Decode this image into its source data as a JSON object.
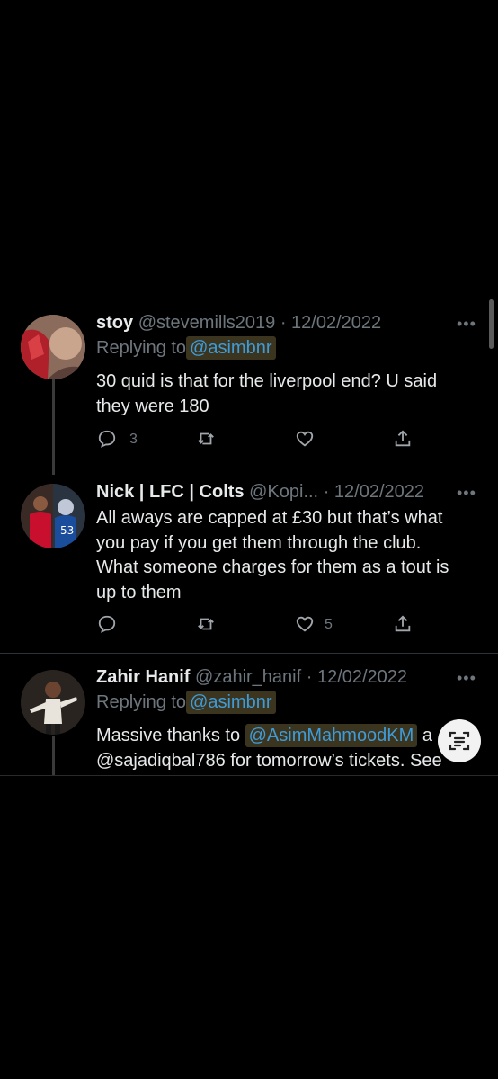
{
  "tweets": [
    {
      "name": "stoy",
      "handle": "@stevemills2019",
      "date": "· 12/02/2022",
      "replying_prefix": "Replying to",
      "replying_to": "@asimbnr",
      "text_lines": [
        "30 quid is that for the liverpool end? U said",
        "they were 180"
      ],
      "reply_count": "3",
      "like_count": ""
    },
    {
      "name": "Nick | LFC | Colts",
      "handle": "@Kopi...",
      "date": "· 12/02/2022",
      "text_lines": [
        "All aways are capped at £30 but that’s what",
        "you pay if you get them through the club.",
        "What someone charges for them as a tout is",
        "up to them"
      ],
      "reply_count": "",
      "like_count": "5"
    },
    {
      "name": "Zahir Hanif",
      "handle": "@zahir_hanif",
      "date": "· 12/02/2022",
      "replying_prefix": "Replying to",
      "replying_to": "@asimbnr",
      "text_pre": "Massive thanks to ",
      "text_mention": "@AsimMahmoodKM",
      "text_post": " a",
      "text_line2": "@sajadiqbal786 for tomorrow’s tickets. See"
    }
  ],
  "more_icon": "•••",
  "icons": [
    "reply-icon",
    "retweet-icon",
    "like-icon",
    "share-icon",
    "text-scan-icon"
  ],
  "colors": {
    "mention": "#3f9bd8",
    "highlight": "#3b3520",
    "muted": "#6e767d"
  }
}
